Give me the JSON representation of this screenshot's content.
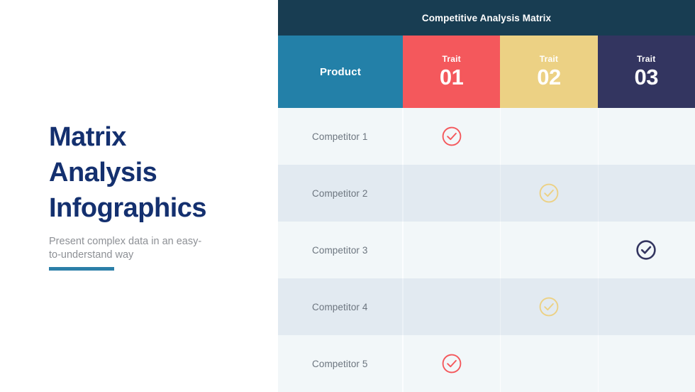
{
  "left": {
    "title": "Matrix\nAnalysis\nInfographics",
    "subtitle": "Present complex data in an easy-\nto-understand way",
    "title_color": "#14306f",
    "subtitle_color": "#8d9095",
    "accent_bar_color": "#2c7fa8"
  },
  "matrix": {
    "header_bar_title": "Competitive Analysis Matrix",
    "header_bar_color": "#183d52",
    "columns": [
      {
        "key": "product",
        "label": "Product",
        "eyebrow": "",
        "number": "",
        "color": "#2380a8"
      },
      {
        "key": "trait01",
        "label": "",
        "eyebrow": "Trait",
        "number": "01",
        "color": "#f4585c"
      },
      {
        "key": "trait02",
        "label": "",
        "eyebrow": "Trait",
        "number": "02",
        "color": "#ecd184"
      },
      {
        "key": "trait03",
        "label": "",
        "eyebrow": "Trait",
        "number": "03",
        "color": "#333560"
      }
    ],
    "row_colors": {
      "odd": "#f2f7f9",
      "even": "#e2eaf1"
    },
    "rows": [
      {
        "label": "Competitor 1",
        "marks": [
          true,
          false,
          false
        ],
        "icon": "check-circle-icon"
      },
      {
        "label": "Competitor 2",
        "marks": [
          false,
          true,
          false
        ],
        "icon": "check-circle-icon"
      },
      {
        "label": "Competitor 3",
        "marks": [
          false,
          false,
          true
        ],
        "icon": "check-circle-icon"
      },
      {
        "label": "Competitor 4",
        "marks": [
          false,
          true,
          false
        ],
        "icon": "check-circle-icon"
      },
      {
        "label": "Competitor 5",
        "marks": [
          true,
          false,
          false
        ],
        "icon": "check-circle-icon"
      }
    ]
  }
}
